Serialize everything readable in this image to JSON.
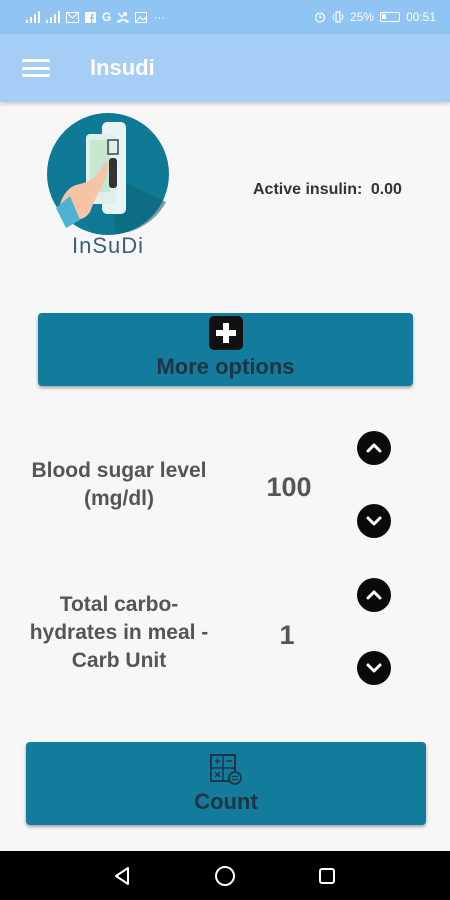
{
  "status_bar": {
    "left_icons": [
      "signal-icon",
      "signal-icon",
      "mail-icon",
      "facebook-icon",
      "g-icon",
      "missed-call-icon",
      "image-icon",
      "more-icon"
    ],
    "battery_percent": "25%",
    "time": "00:51"
  },
  "app_bar": {
    "title": "Insudi",
    "menu_icon": "hamburger-menu-icon"
  },
  "logo": {
    "text": "InSuDi"
  },
  "active_insulin": {
    "label": "Active insulin:",
    "value": "0.00"
  },
  "more_options": {
    "label": "More options",
    "icon": "plus-box-icon"
  },
  "blood_sugar": {
    "label_line1": "Blood sugar level",
    "label_line2": "(mg/dl)",
    "value": "100"
  },
  "carbs": {
    "label_line1": "Total carbo-",
    "label_line2": "hydrates in meal -",
    "label_line3": "Carb Unit",
    "value": "1"
  },
  "count_button": {
    "label": "Count",
    "icon": "calculator-icon"
  },
  "colors": {
    "status_bar": "#90c4f2",
    "app_bar": "#a6cdf5",
    "button": "#137b9b",
    "background": "#f7f7f7"
  }
}
